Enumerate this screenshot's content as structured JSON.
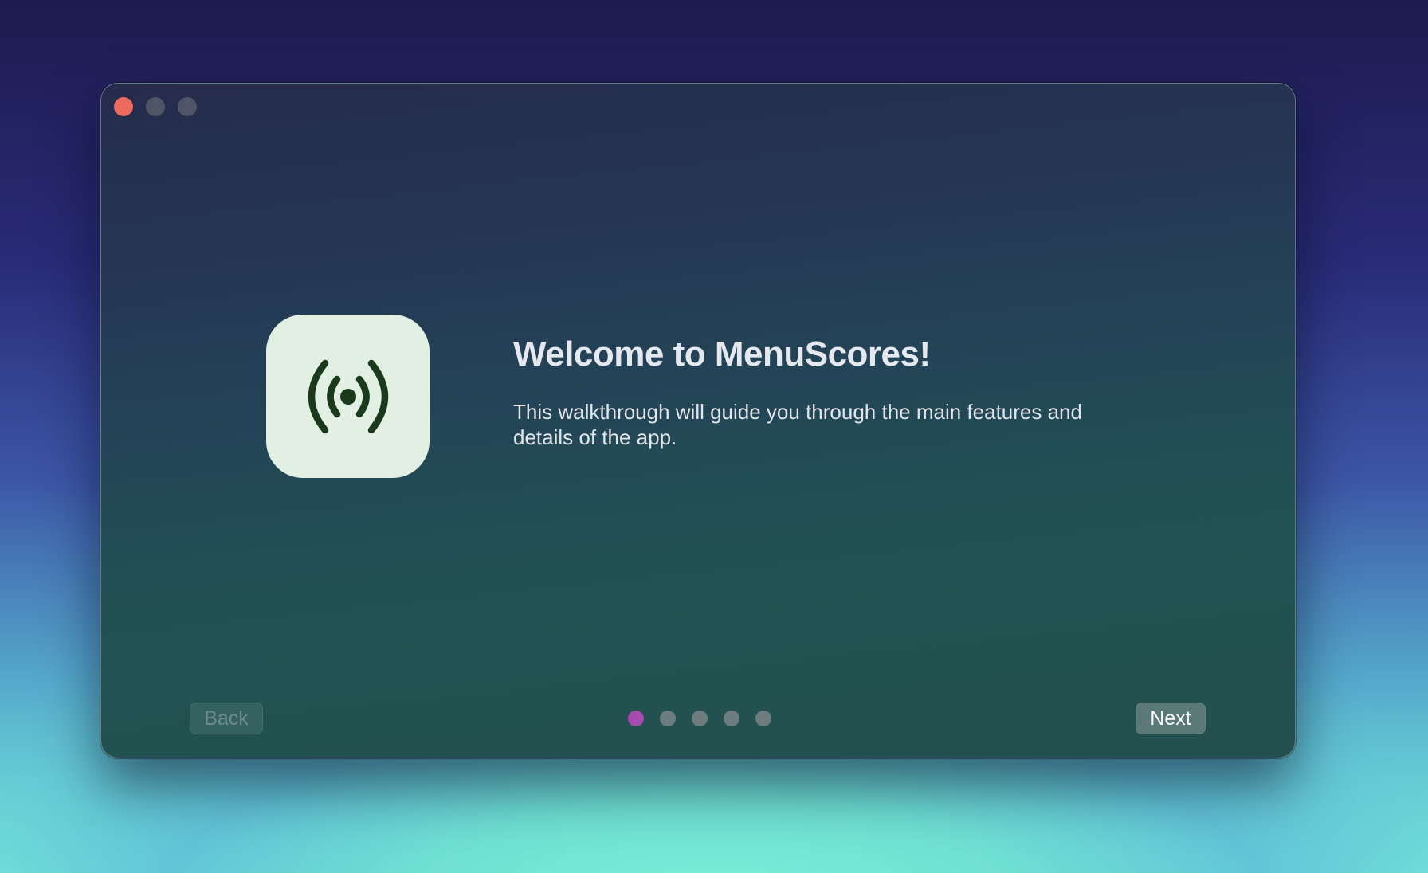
{
  "window": {
    "traffic_lights": [
      "close",
      "minimize",
      "zoom"
    ]
  },
  "app_icon": {
    "icon_name": "broadcast-signal-icon",
    "background_color": "#e1f0e3",
    "glyph_color": "#1b3a1c"
  },
  "welcome": {
    "title": "Welcome to MenuScores!",
    "description": "This walkthrough will guide you through the main features and details of the app."
  },
  "navigation": {
    "back_label": "Back",
    "next_label": "Next",
    "back_enabled": false,
    "page_count": 5,
    "current_page": 1
  },
  "colors": {
    "accent_dot": "#a84bae",
    "inactive_dot": "#6d7c7d",
    "close_button": "#ec6a5e"
  }
}
